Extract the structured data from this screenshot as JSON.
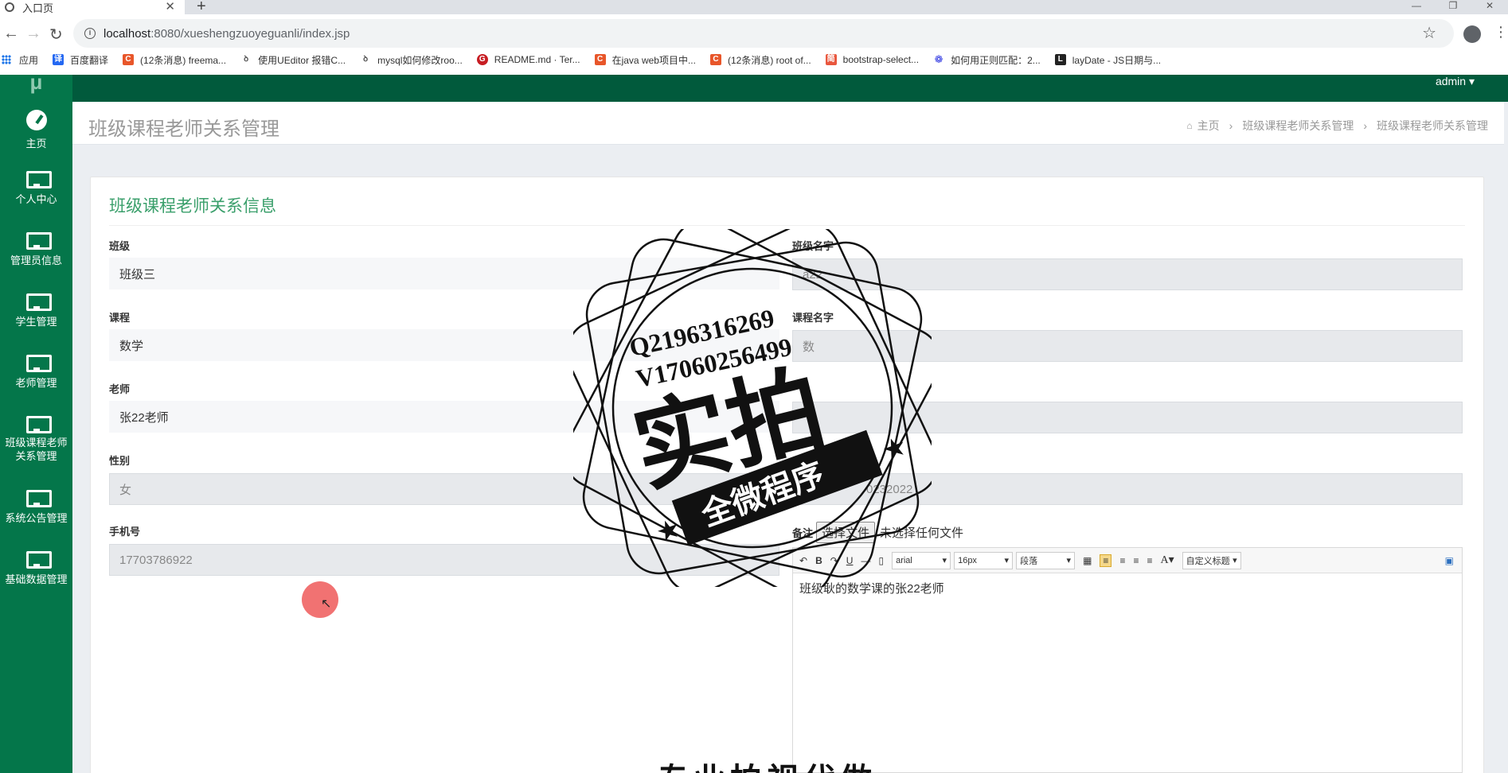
{
  "browser": {
    "tab_title": "入口页",
    "url_host": "localhost",
    "url_path": ":8080/xueshengzuoyeguanli/index.jsp",
    "bookmarks": [
      {
        "label": "应用",
        "icon": "apps-grid-icon",
        "color": "#1a73e8"
      },
      {
        "label": "百度翻译",
        "icon": "translate-icon",
        "color": "#2468f2"
      },
      {
        "label": "(12条消息) freema...",
        "icon": "csdn-icon",
        "color": "#e8562a"
      },
      {
        "label": "使用UEditor 报错C...",
        "icon": "site-icon",
        "color": "#555555"
      },
      {
        "label": "mysql如何修改roo...",
        "icon": "site-icon",
        "color": "#555555"
      },
      {
        "label": "README.md · Ter...",
        "icon": "gitee-icon",
        "color": "#c71d23"
      },
      {
        "label": "在java web项目中...",
        "icon": "csdn-icon",
        "color": "#e8562a"
      },
      {
        "label": "(12条消息) root of...",
        "icon": "csdn-icon",
        "color": "#e8562a"
      },
      {
        "label": "bootstrap-select...",
        "icon": "jianshu-icon",
        "color": "#e9573e"
      },
      {
        "label": "如何用正则匹配：2...",
        "icon": "baidu-paw-icon",
        "color": "#2932e1"
      },
      {
        "label": "layDate - JS日期与...",
        "icon": "laydate-icon",
        "color": "#222222"
      }
    ]
  },
  "app": {
    "logo_text": "μ",
    "admin_label": "admin ▾",
    "sidebar": [
      {
        "label": "主页",
        "icon": "dashboard-icon"
      },
      {
        "label": "个人中心",
        "icon": "monitor-icon"
      },
      {
        "label": "管理员信息",
        "icon": "monitor-icon"
      },
      {
        "label": "学生管理",
        "icon": "monitor-icon"
      },
      {
        "label": "老师管理",
        "icon": "monitor-icon"
      },
      {
        "label": "班级课程老师关系管理",
        "label_line1": "班级课程老师",
        "label_line2": "关系管理",
        "icon": "monitor-icon"
      },
      {
        "label": "系统公告管理",
        "icon": "monitor-icon"
      },
      {
        "label": "基础数据管理",
        "icon": "monitor-icon"
      }
    ],
    "page_title": "班级课程老师关系管理",
    "breadcrumb": [
      "主页",
      "班级课程老师关系管理",
      "班级课程老师关系管理"
    ],
    "panel_title": "班级课程老师关系信息",
    "fields": {
      "class": {
        "label": "班级",
        "value": "班级三"
      },
      "class_name": {
        "label": "班级名字",
        "value": "a22"
      },
      "course": {
        "label": "课程",
        "value": "数学"
      },
      "course_name": {
        "label": "课程名字",
        "value": "数"
      },
      "teacher": {
        "label": "老师",
        "value": "张22老师"
      },
      "gender": {
        "label": "性别",
        "value": "女"
      },
      "id_number": {
        "label": "身份证",
        "value": "0232022"
      },
      "phone": {
        "label": "手机号",
        "value": "17703786922"
      },
      "remark": {
        "label": "备注",
        "file_button": "选择文件",
        "file_status": "未选择任何文件"
      }
    },
    "editor": {
      "font_family": "arial",
      "font_size": "16px",
      "paragraph": "段落",
      "custom_title": "自定义标题",
      "content": "班级耿的数学课的张22老师"
    }
  },
  "watermark": {
    "contact_q": "Q2196316269",
    "contact_v": "V17060256499",
    "main_text": "实拍",
    "ribbon_text": "全微程序",
    "bottom_text": "专业拍视代做"
  },
  "colors": {
    "sidebar": "#04764a",
    "topbar": "#015a3c",
    "accent": "#3a9f6b"
  }
}
